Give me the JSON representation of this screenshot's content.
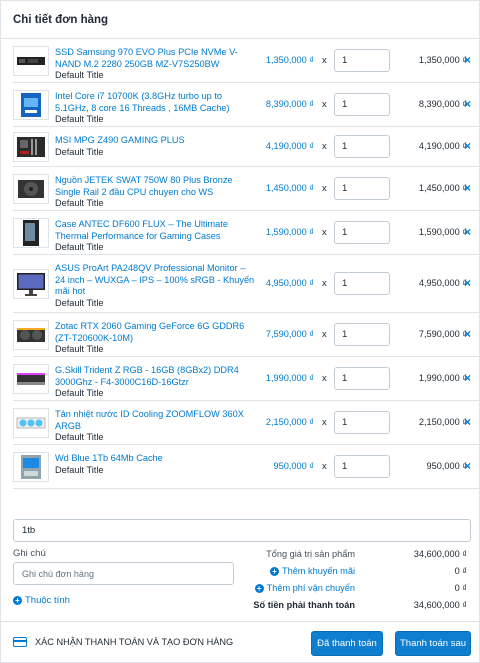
{
  "header": {
    "title": "Chi tiết đơn hàng"
  },
  "items": [
    {
      "name": "SSD Samsung 970 EVO Plus PCIe NVMe V-NAND M.2 2280 250GB MZ-V7S250BW",
      "variant": "Default Title",
      "price": "1,350,000 ₫",
      "qty": "1",
      "total": "1,350,000 ₫",
      "thumb": "ssd-image"
    },
    {
      "name": "Intel Core i7 10700K (3.8GHz turbo up to 5.1GHz, 8 core 16 Threads , 16MB Cache)",
      "variant": "Default Title",
      "price": "8,390,000 ₫",
      "qty": "1",
      "total": "8,390,000 ₫",
      "thumb": "cpu-box-image"
    },
    {
      "name": "MSI MPG Z490 GAMING PLUS",
      "variant": "Default Title",
      "price": "4,190,000 ₫",
      "qty": "1",
      "total": "4,190,000 ₫",
      "thumb": "motherboard-image"
    },
    {
      "name": "Nguồn JETEK SWAT 750W 80 Plus Bronze Single Rail 2 đầu CPU chuyen cho WS",
      "variant": "Default Title",
      "price": "1,450,000 ₫",
      "qty": "1",
      "total": "1,450,000 ₫",
      "thumb": "psu-image"
    },
    {
      "name": "Case ANTEC DF600 FLUX – The Ultimate Thermal Performance for Gaming Cases",
      "variant": "Default Title",
      "price": "1,590,000 ₫",
      "qty": "1",
      "total": "1,590,000 ₫",
      "thumb": "case-image"
    },
    {
      "name": "ASUS ProArt PA248QV Professional Monitor – 24 inch – WUXGA – IPS – 100% sRGB - Khuyến mãi hot",
      "variant": "Default Title",
      "price": "4,950,000 ₫",
      "qty": "1",
      "total": "4,950,000 ₫",
      "thumb": "monitor-image"
    },
    {
      "name": "Zotac RTX 2060 Gaming GeForce 6G GDDR6 (ZT-T20600K-10M)",
      "variant": "Default Title",
      "price": "7,590,000 ₫",
      "qty": "1",
      "total": "7,590,000 ₫",
      "thumb": "gpu-image"
    },
    {
      "name": "G.Skill Trident Z RGB - 16GB (8GBx2) DDR4 3000Ghz - F4-3000C16D-16Gtzr",
      "variant": "Default Title",
      "price": "1,990,000 ₫",
      "qty": "1",
      "total": "1,990,000 ₫",
      "thumb": "ram-image"
    },
    {
      "name": "Tản nhiệt nước ID Cooling ZOOMFLOW 360X ARGB",
      "variant": "Default Title",
      "price": "2,150,000 ₫",
      "qty": "1",
      "total": "2,150,000 ₫",
      "thumb": "cooler-image"
    },
    {
      "name": "Wd Blue 1Tb 64Mb Cache",
      "variant": "Default Title",
      "price": "950,000 ₫",
      "qty": "1",
      "total": "950,000 ₫",
      "thumb": "hdd-image"
    }
  ],
  "times_sign": "x",
  "remove_icon": "×",
  "tag_input": {
    "value": "1tb"
  },
  "note": {
    "label": "Ghi chú",
    "placeholder": "Ghi chú đơn hàng"
  },
  "attributes_link": "Thuộc tính",
  "summary": {
    "subtotal_label": "Tổng giá trị sản phẩm",
    "subtotal_value": "34,600,000 ₫",
    "discount_label": "Thêm khuyến mãi",
    "discount_value": "0 ₫",
    "shipping_label": "Thêm phí vận chuyển",
    "shipping_value": "0 ₫",
    "total_label": "Số tiền phải thanh toán",
    "total_value": "34,600,000 ₫"
  },
  "footer": {
    "confirm_label": "XÁC NHẬN THANH TOÁN VÀ TẠO ĐƠN HÀNG",
    "paid_button": "Đã thanh toán",
    "pay_later_button": "Thanh toán sau"
  },
  "colors": {
    "accent": "#007ace",
    "button": "#0e7ed0",
    "border": "#dfe3e8"
  }
}
